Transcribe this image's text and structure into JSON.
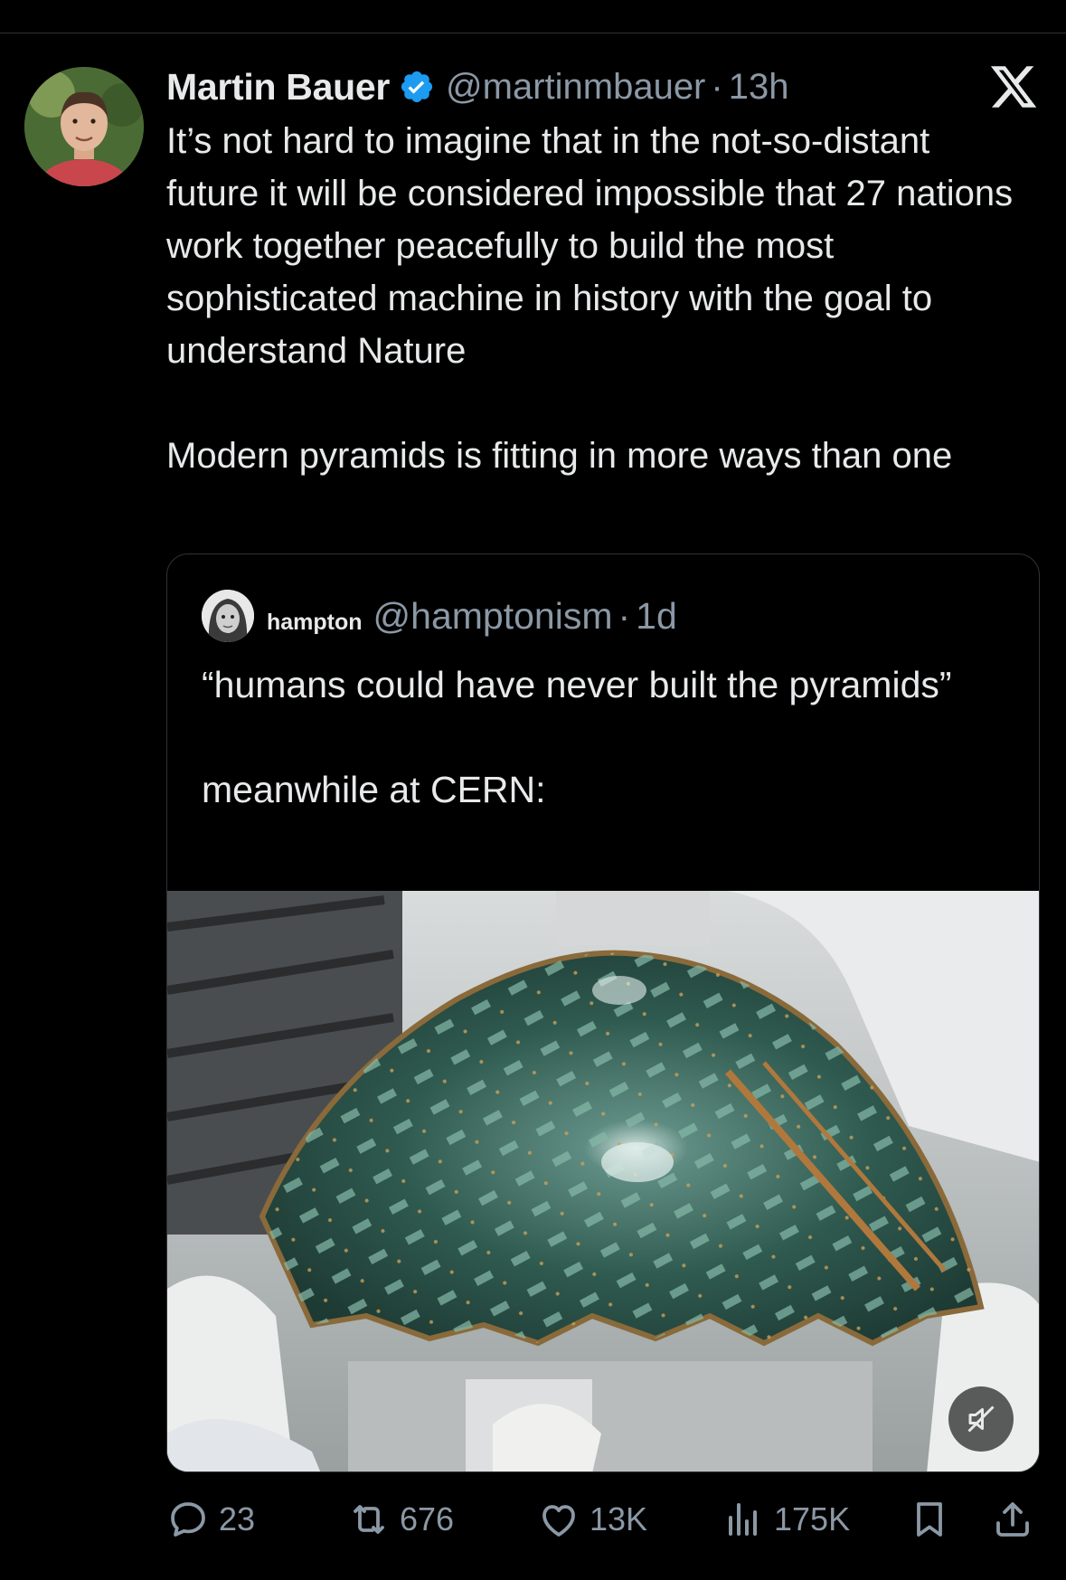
{
  "tweet": {
    "author_name": "Martin Bauer",
    "author_handle": "@martinmbauer",
    "separator": "·",
    "time": "13h",
    "body_paragraphs": [
      "It’s not hard to imagine that in the not-so-distant future it will be considered impossible that 27 nations work together peacefully to build the most sophisticated machine in history with the goal to understand Nature",
      "Modern pyramids is fitting in more ways than one"
    ]
  },
  "quote": {
    "author_name": "hampton",
    "author_handle": "@hamptonism",
    "separator": "·",
    "time": "1d",
    "body_paragraphs": [
      "“humans could have never built the pyramids”",
      "meanwhile at CERN:"
    ]
  },
  "actions": {
    "replies": "23",
    "reposts": "676",
    "likes": "13K",
    "views": "175K"
  },
  "colors": {
    "background": "#000000",
    "text": "#e7e9ea",
    "secondary": "#8b98a5",
    "verified": "#1d9bf0",
    "border": "#2f3336"
  },
  "icons": [
    "verified-badge-icon",
    "x-logo-icon",
    "mute-icon",
    "reply-icon",
    "repost-icon",
    "like-icon",
    "views-icon",
    "bookmark-icon",
    "share-icon"
  ]
}
